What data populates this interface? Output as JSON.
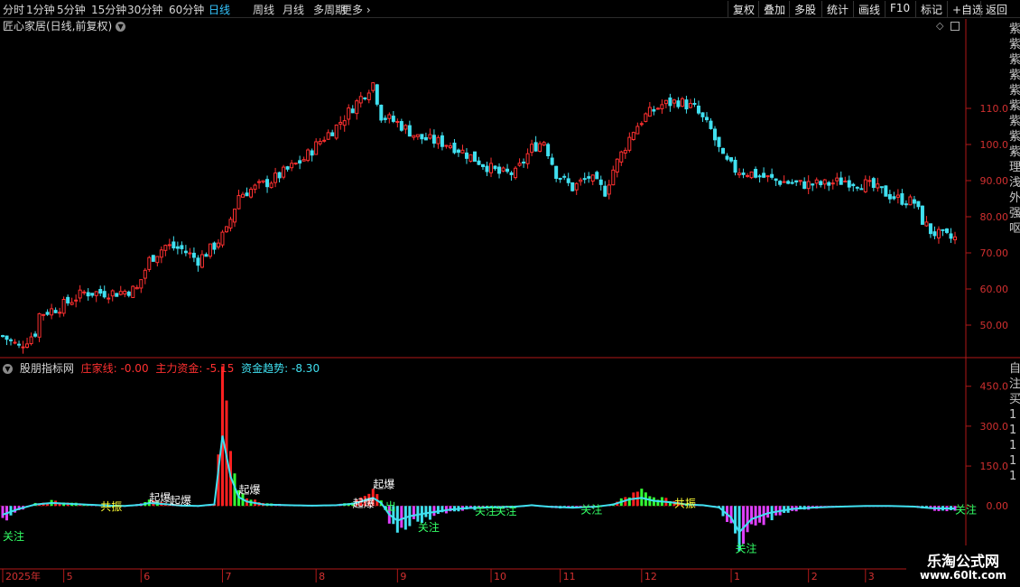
{
  "toolbar": {
    "periods": [
      "分时",
      "1分钟",
      "5分钟",
      "15分钟",
      "30分钟",
      "60分钟",
      "日线",
      "周线",
      "月线",
      "多周期",
      "更多"
    ],
    "active_period": "日线",
    "buttons": [
      "复权",
      "叠加",
      "多股",
      "统计",
      "画线",
      "F10",
      "标记",
      "+自选",
      "返回"
    ]
  },
  "main_chart": {
    "title": "匠心家居(日线,前复权)",
    "y_ticks": [
      "110.0",
      "100.0",
      "90.00",
      "80.00",
      "70.00",
      "60.00",
      "50.00"
    ],
    "y_range": [
      42,
      130
    ],
    "side_chars": [
      "紫",
      "紫",
      "紫",
      "紫",
      "紫",
      "紫",
      "紫",
      "紫",
      "紫",
      "理",
      "浅",
      "外",
      "强",
      "呕"
    ]
  },
  "indicator": {
    "name": "股朋指标网",
    "zhuangjia_label": "庄家线: -0.00",
    "zhuli_label": "主力资金: -5.15",
    "qushi_label": "资金趋势: -8.30",
    "y_ticks": [
      "450.0",
      "300.0",
      "150.0",
      "0.00"
    ],
    "y_range": [
      -220,
      500
    ],
    "side_chars": [
      "自",
      "注",
      "买",
      "1",
      "1",
      "1",
      "1",
      "1"
    ],
    "annotations": [
      {
        "text": "关注",
        "color": "#33ff66",
        "xi": 0,
        "v": -115
      },
      {
        "text": "共振",
        "color": "#ffff33",
        "xi": 24,
        "v": -2
      },
      {
        "text": "起爆",
        "color": "#ffffff",
        "xi": 36,
        "v": 30
      },
      {
        "text": "起爆",
        "color": "#ffffff",
        "xi": 41,
        "v": 20
      },
      {
        "text": "起爆",
        "color": "#ffffff",
        "xi": 58,
        "v": 60
      },
      {
        "text": "起爆",
        "color": "#ffffff",
        "xi": 91,
        "v": 80
      },
      {
        "text": "起爆",
        "color": "#ffffff",
        "xi": 86,
        "v": 10
      },
      {
        "text": "出",
        "color": "#33ff66",
        "xi": 94,
        "v": -2
      },
      {
        "text": "关注",
        "color": "#33ff66",
        "xi": 102,
        "v": -80
      },
      {
        "text": "关注",
        "color": "#33ff66",
        "xi": 116,
        "v": -20
      },
      {
        "text": "关注",
        "color": "#33ff66",
        "xi": 121,
        "v": -20
      },
      {
        "text": "关注",
        "color": "#33ff66",
        "xi": 142,
        "v": -15
      },
      {
        "text": "共振",
        "color": "#ffff33",
        "xi": 165,
        "v": 10
      },
      {
        "text": "关注",
        "color": "#33ff66",
        "xi": 180,
        "v": -160
      },
      {
        "text": "关注",
        "color": "#33ff66",
        "xi": 234,
        "v": -15
      }
    ]
  },
  "x_axis": {
    "labels": [
      {
        "text": "2025年",
        "i": 0
      },
      {
        "text": "5",
        "i": 15
      },
      {
        "text": "6",
        "i": 34
      },
      {
        "text": "7",
        "i": 54
      },
      {
        "text": "8",
        "i": 77
      },
      {
        "text": "9",
        "i": 97
      },
      {
        "text": "10",
        "i": 120
      },
      {
        "text": "11",
        "i": 137
      },
      {
        "text": "12",
        "i": 157
      },
      {
        "text": "1",
        "i": 179
      },
      {
        "text": "2",
        "i": 198
      },
      {
        "text": "3",
        "i": 212
      }
    ]
  },
  "watermark": {
    "line1": "乐淘公式网",
    "line2": "www.60lt.com"
  },
  "colors": {
    "up": "#ff3030",
    "down": "#40e0f0",
    "axis_red": "#b01818",
    "grid": "#7a1010"
  },
  "chart_data": {
    "type": "candlestick",
    "price_path": [
      [
        0,
        47
      ],
      [
        4,
        44
      ],
      [
        8,
        48
      ],
      [
        9,
        53
      ],
      [
        14,
        55
      ],
      [
        20,
        59
      ],
      [
        28,
        59
      ],
      [
        33,
        60
      ],
      [
        36,
        68
      ],
      [
        40,
        72
      ],
      [
        44,
        71
      ],
      [
        48,
        68
      ],
      [
        52,
        72
      ],
      [
        55,
        76
      ],
      [
        58,
        86
      ],
      [
        62,
        88
      ],
      [
        66,
        90
      ],
      [
        70,
        93
      ],
      [
        74,
        96
      ],
      [
        78,
        101
      ],
      [
        82,
        105
      ],
      [
        88,
        113
      ],
      [
        91,
        117
      ],
      [
        93,
        108
      ],
      [
        97,
        106
      ],
      [
        102,
        102
      ],
      [
        110,
        100
      ],
      [
        116,
        96
      ],
      [
        122,
        92
      ],
      [
        126,
        92
      ],
      [
        130,
        99
      ],
      [
        133,
        101
      ],
      [
        136,
        92
      ],
      [
        140,
        88
      ],
      [
        144,
        91
      ],
      [
        148,
        87
      ],
      [
        150,
        93
      ],
      [
        155,
        104
      ],
      [
        158,
        108
      ],
      [
        162,
        111
      ],
      [
        166,
        112
      ],
      [
        170,
        110
      ],
      [
        174,
        104
      ],
      [
        177,
        96
      ],
      [
        180,
        93
      ],
      [
        184,
        92
      ],
      [
        190,
        90
      ],
      [
        196,
        89
      ],
      [
        202,
        89
      ],
      [
        207,
        90
      ],
      [
        212,
        89
      ],
      [
        216,
        87
      ],
      [
        220,
        85
      ],
      [
        224,
        84
      ],
      [
        226,
        79
      ],
      [
        228,
        76
      ],
      [
        230,
        75
      ],
      [
        233,
        74
      ]
    ],
    "indicator_path": [
      [
        0,
        -60
      ],
      [
        4,
        -20
      ],
      [
        8,
        10
      ],
      [
        12,
        20
      ],
      [
        16,
        15
      ],
      [
        20,
        10
      ],
      [
        26,
        2
      ],
      [
        30,
        0
      ],
      [
        34,
        8
      ],
      [
        36,
        20
      ],
      [
        40,
        12
      ],
      [
        44,
        2
      ],
      [
        48,
        0
      ],
      [
        52,
        10
      ],
      [
        54,
        480
      ],
      [
        56,
        200
      ],
      [
        58,
        60
      ],
      [
        60,
        30
      ],
      [
        64,
        10
      ],
      [
        70,
        5
      ],
      [
        76,
        2
      ],
      [
        82,
        5
      ],
      [
        86,
        15
      ],
      [
        88,
        30
      ],
      [
        91,
        55
      ],
      [
        93,
        20
      ],
      [
        95,
        -60
      ],
      [
        97,
        -100
      ],
      [
        100,
        -70
      ],
      [
        104,
        -50
      ],
      [
        110,
        -25
      ],
      [
        114,
        -15
      ],
      [
        120,
        -10
      ],
      [
        126,
        -5
      ],
      [
        130,
        5
      ],
      [
        134,
        -5
      ],
      [
        140,
        -12
      ],
      [
        146,
        -5
      ],
      [
        150,
        10
      ],
      [
        154,
        45
      ],
      [
        157,
        55
      ],
      [
        160,
        35
      ],
      [
        164,
        25
      ],
      [
        168,
        10
      ],
      [
        172,
        5
      ],
      [
        176,
        -10
      ],
      [
        179,
        -80
      ],
      [
        181,
        -180
      ],
      [
        184,
        -90
      ],
      [
        188,
        -50
      ],
      [
        194,
        -20
      ],
      [
        200,
        -10
      ],
      [
        206,
        -5
      ],
      [
        212,
        0
      ],
      [
        218,
        0
      ],
      [
        224,
        -5
      ],
      [
        228,
        -15
      ],
      [
        233,
        -18
      ]
    ]
  }
}
